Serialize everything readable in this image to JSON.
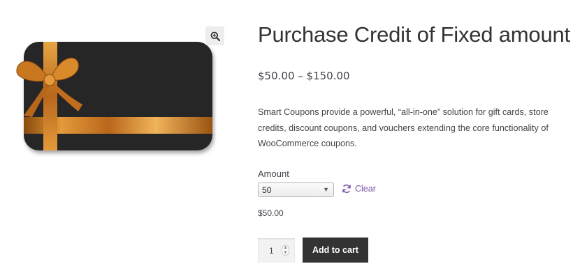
{
  "product": {
    "title": "Purchase Credit of Fixed amount",
    "price_range": "$50.00 – $150.00",
    "description": "Smart Coupons provide a powerful, “all-in-one” solution for gift cards, store credits, discount coupons, and vouchers extending the core functionality of WooCommerce coupons.",
    "image_alt": "gift-card-image"
  },
  "gallery": {
    "zoom_icon": "magnifier-plus-icon"
  },
  "variations": {
    "amount_label": "Amount",
    "selected_amount": "50",
    "clear_label": "Clear",
    "clear_icon": "refresh-icon",
    "selected_price": "$50.00"
  },
  "cart": {
    "quantity": "1",
    "add_to_cart_label": "Add to cart"
  },
  "colors": {
    "link": "#7c57a8",
    "button_bg": "#333333",
    "card_bg": "#262626",
    "ribbon": "#c8761d"
  }
}
